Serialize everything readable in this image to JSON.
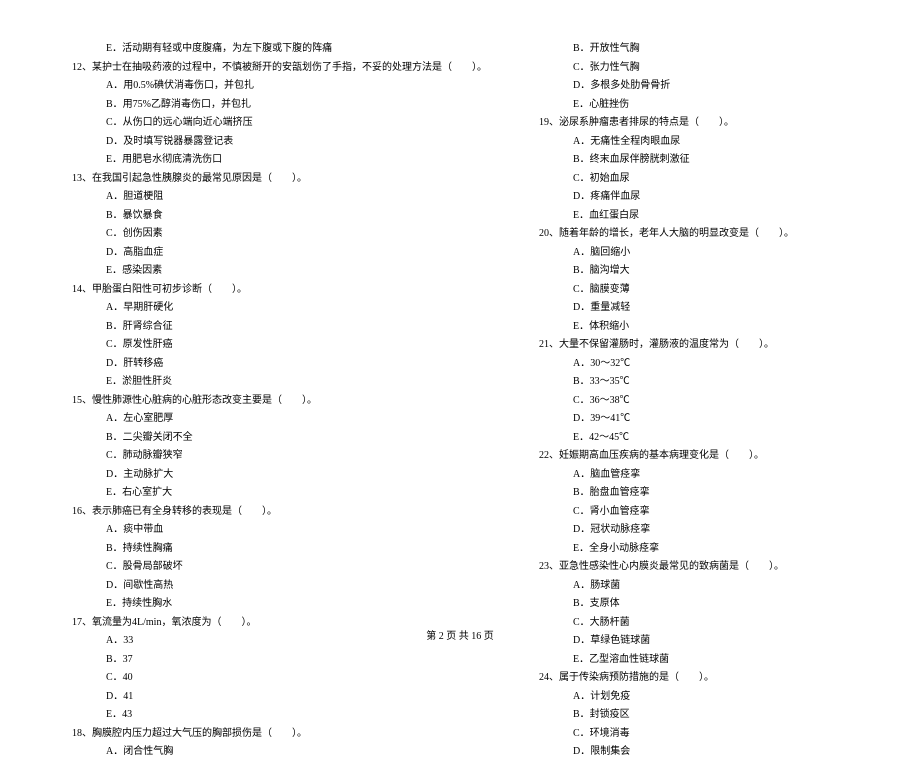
{
  "leftColumn": [
    {
      "type": "opt",
      "text": "E．活动期有轻或中度腹痛，为左下腹或下腹的阵痛"
    },
    {
      "type": "q",
      "text": "12、某护士在抽吸药液的过程中，不慎被掰开的安瓿划伤了手指，不妥的处理方法是（　　）。"
    },
    {
      "type": "opt",
      "text": "A．用0.5%碘伏消毒伤口，并包扎"
    },
    {
      "type": "opt",
      "text": "B．用75%乙醇消毒伤口，并包扎"
    },
    {
      "type": "opt",
      "text": "C．从伤口的远心端向近心端挤压"
    },
    {
      "type": "opt",
      "text": "D．及时填写锐器暴露登记表"
    },
    {
      "type": "opt",
      "text": "E．用肥皂水彻底清洗伤口"
    },
    {
      "type": "q",
      "text": "13、在我国引起急性胰腺炎的最常见原因是（　　）。"
    },
    {
      "type": "opt",
      "text": "A．胆道梗阻"
    },
    {
      "type": "opt",
      "text": "B．暴饮暴食"
    },
    {
      "type": "opt",
      "text": "C．创伤因素"
    },
    {
      "type": "opt",
      "text": "D．高脂血症"
    },
    {
      "type": "opt",
      "text": "E．感染因素"
    },
    {
      "type": "q",
      "text": "14、甲胎蛋白阳性可初步诊断（　　）。"
    },
    {
      "type": "opt",
      "text": "A．早期肝硬化"
    },
    {
      "type": "opt",
      "text": "B．肝肾综合征"
    },
    {
      "type": "opt",
      "text": "C．原发性肝癌"
    },
    {
      "type": "opt",
      "text": "D．肝转移癌"
    },
    {
      "type": "opt",
      "text": "E．淤胆性肝炎"
    },
    {
      "type": "q",
      "text": "15、慢性肺源性心脏病的心脏形态改变主要是（　　）。"
    },
    {
      "type": "opt",
      "text": "A．左心室肥厚"
    },
    {
      "type": "opt",
      "text": "B．二尖瓣关闭不全"
    },
    {
      "type": "opt",
      "text": "C．肺动脉瓣狭窄"
    },
    {
      "type": "opt",
      "text": "D．主动脉扩大"
    },
    {
      "type": "opt",
      "text": "E．右心室扩大"
    },
    {
      "type": "q",
      "text": "16、表示肺癌已有全身转移的表现是（　　）。"
    },
    {
      "type": "opt",
      "text": "A．痰中带血"
    },
    {
      "type": "opt",
      "text": "B．持续性胸痛"
    },
    {
      "type": "opt",
      "text": "C．股骨局部破坏"
    },
    {
      "type": "opt",
      "text": "D．间歇性高热"
    },
    {
      "type": "opt",
      "text": "E．持续性胸水"
    },
    {
      "type": "q",
      "text": "17、氧流量为4L/min，氧浓度为（　　）。"
    },
    {
      "type": "opt",
      "text": "A．33"
    },
    {
      "type": "opt",
      "text": "B．37"
    },
    {
      "type": "opt",
      "text": "C．40"
    },
    {
      "type": "opt",
      "text": "D．41"
    },
    {
      "type": "opt",
      "text": "E．43"
    },
    {
      "type": "q",
      "text": "18、胸膜腔内压力超过大气压的胸部损伤是（　　）。"
    },
    {
      "type": "opt",
      "text": "A．闭合性气胸"
    }
  ],
  "rightColumn": [
    {
      "type": "opt",
      "text": "B．开放性气胸"
    },
    {
      "type": "opt",
      "text": "C．张力性气胸"
    },
    {
      "type": "opt",
      "text": "D．多根多处肋骨骨折"
    },
    {
      "type": "opt",
      "text": "E．心脏挫伤"
    },
    {
      "type": "q",
      "text": "19、泌尿系肿瘤患者排尿的特点是（　　）。"
    },
    {
      "type": "opt",
      "text": "A．无痛性全程肉眼血尿"
    },
    {
      "type": "opt",
      "text": "B．终末血尿伴膀胱刺激征"
    },
    {
      "type": "opt",
      "text": "C．初始血尿"
    },
    {
      "type": "opt",
      "text": "D．疼痛伴血尿"
    },
    {
      "type": "opt",
      "text": "E．血红蛋白尿"
    },
    {
      "type": "q",
      "text": "20、随着年龄的增长，老年人大脑的明显改变是（　　）。"
    },
    {
      "type": "opt",
      "text": "A．脑回缩小"
    },
    {
      "type": "opt",
      "text": "B．脑沟增大"
    },
    {
      "type": "opt",
      "text": "C．脑膜变薄"
    },
    {
      "type": "opt",
      "text": "D．重量减轻"
    },
    {
      "type": "opt",
      "text": "E．体积缩小"
    },
    {
      "type": "q",
      "text": "21、大量不保留灌肠时，灌肠液的温度常为（　　）。"
    },
    {
      "type": "opt",
      "text": "A．30～32℃"
    },
    {
      "type": "opt",
      "text": "B．33～35℃"
    },
    {
      "type": "opt",
      "text": "C．36～38℃"
    },
    {
      "type": "opt",
      "text": "D．39～41℃"
    },
    {
      "type": "opt",
      "text": "E．42～45℃"
    },
    {
      "type": "q",
      "text": "22、妊娠期高血压疾病的基本病理变化是（　　）。"
    },
    {
      "type": "opt",
      "text": "A．脑血管痉挛"
    },
    {
      "type": "opt",
      "text": "B．胎盘血管痉挛"
    },
    {
      "type": "opt",
      "text": "C．肾小血管痉挛"
    },
    {
      "type": "opt",
      "text": "D．冠状动脉痉挛"
    },
    {
      "type": "opt",
      "text": "E．全身小动脉痉挛"
    },
    {
      "type": "q",
      "text": "23、亚急性感染性心内膜炎最常见的致病菌是（　　）。"
    },
    {
      "type": "opt",
      "text": "A．肠球菌"
    },
    {
      "type": "opt",
      "text": "B．支原体"
    },
    {
      "type": "opt",
      "text": "C．大肠杆菌"
    },
    {
      "type": "opt",
      "text": "D．草绿色链球菌"
    },
    {
      "type": "opt",
      "text": "E．乙型溶血性链球菌"
    },
    {
      "type": "q",
      "text": "24、属于传染病预防措施的是（　　）。"
    },
    {
      "type": "opt",
      "text": "A．计划免疫"
    },
    {
      "type": "opt",
      "text": "B．封锁疫区"
    },
    {
      "type": "opt",
      "text": "C．环境消毒"
    },
    {
      "type": "opt",
      "text": "D．限制集会"
    }
  ],
  "footer": "第 2 页 共 16 页"
}
